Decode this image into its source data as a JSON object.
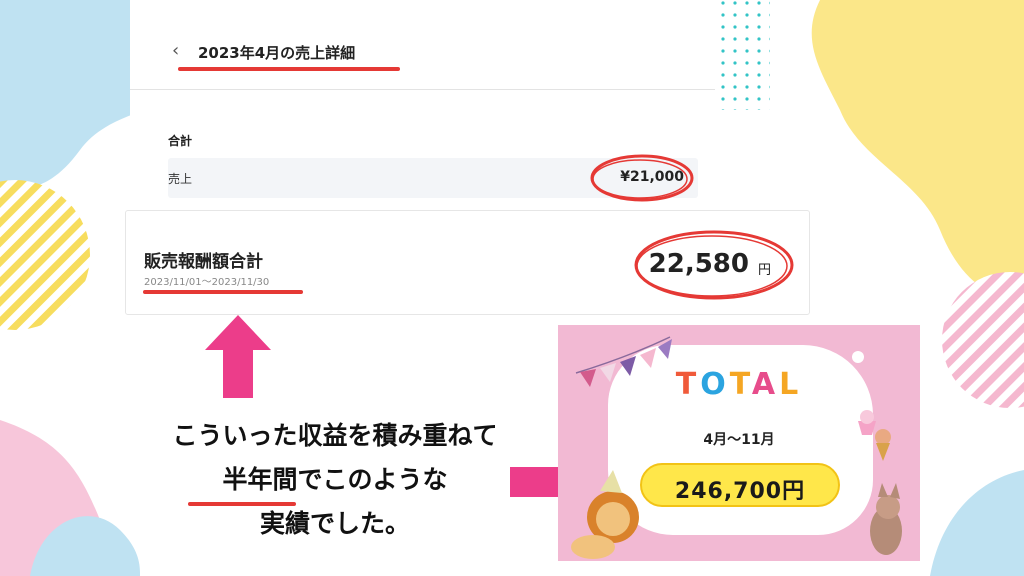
{
  "header": {
    "title": "2023年4月の売上詳細"
  },
  "summary": {
    "total_label": "合計",
    "sales_label": "売上",
    "sales_value": "¥21,000"
  },
  "reward_card": {
    "title": "販売報酬額合計",
    "period": "2023/11/01〜2023/11/30",
    "amount": "22,580",
    "currency": "円"
  },
  "caption": {
    "line1": "こういった収益を積み重ねて",
    "line2": "半年間でこのような",
    "line3": "実績でした。"
  },
  "promo": {
    "total_letters": [
      "T",
      "O",
      "T",
      "A",
      "L"
    ],
    "range": "4月〜11月",
    "amount": "246,700円"
  },
  "colors": {
    "accent_red": "#e53935",
    "arrow_pink": "#ec3d8a",
    "promo_bg": "#f2b9d3",
    "pill_yellow": "#ffe74a"
  }
}
